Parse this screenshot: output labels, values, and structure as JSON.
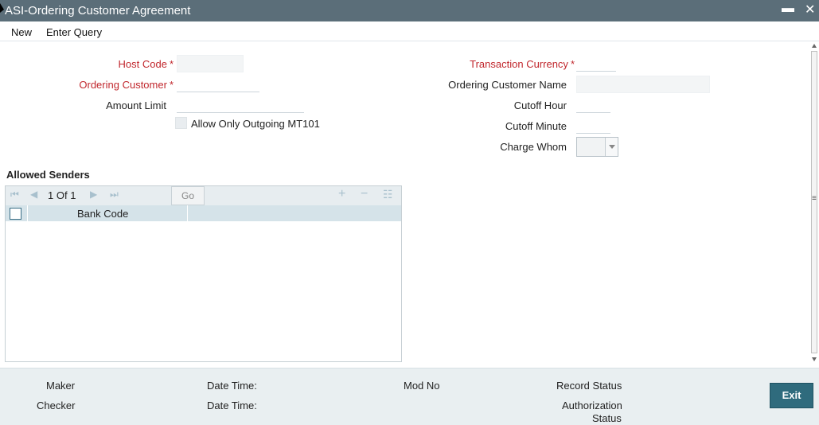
{
  "window": {
    "title": "ASI-Ordering Customer Agreement",
    "minimize_glyph": "▬",
    "close_glyph": "✕"
  },
  "menu": {
    "new_label": "New",
    "enter_query_label": "Enter Query"
  },
  "form": {
    "host_code": {
      "label": "Host Code",
      "value": ""
    },
    "ordering_customer": {
      "label": "Ordering Customer",
      "value": ""
    },
    "amount_limit": {
      "label": "Amount Limit",
      "value": ""
    },
    "allow_outgoing": {
      "label": "Allow Only Outgoing MT101",
      "checked": false
    },
    "transaction_currency": {
      "label": "Transaction Currency",
      "value": ""
    },
    "ordering_customer_name": {
      "label": "Ordering Customer Name",
      "value": ""
    },
    "cutoff_hour": {
      "label": "Cutoff Hour",
      "value": ""
    },
    "cutoff_minute": {
      "label": "Cutoff Minute",
      "value": ""
    },
    "charge_whom": {
      "label": "Charge Whom",
      "value": ""
    },
    "required_mark": "*"
  },
  "allowed_senders": {
    "title": "Allowed Senders",
    "page_current": "1",
    "page_of": "Of",
    "page_total": "1",
    "go_label": "Go",
    "columns": [
      "Bank Code"
    ],
    "rows": []
  },
  "footer": {
    "maker_label": "Maker",
    "checker_label": "Checker",
    "date_time_label_1": "Date Time:",
    "date_time_label_2": "Date Time:",
    "mod_no_label": "Mod No",
    "record_status_label": "Record Status",
    "authorization_label": "Authorization",
    "authorization_status_label": "Status",
    "exit_label": "Exit"
  },
  "colors": {
    "title_bar": "#5b6e79",
    "required_label": "#c1272d",
    "grid_header": "#d5e3e9",
    "footer_bg": "#e9eff1",
    "exit_button": "#2f6b7d"
  }
}
